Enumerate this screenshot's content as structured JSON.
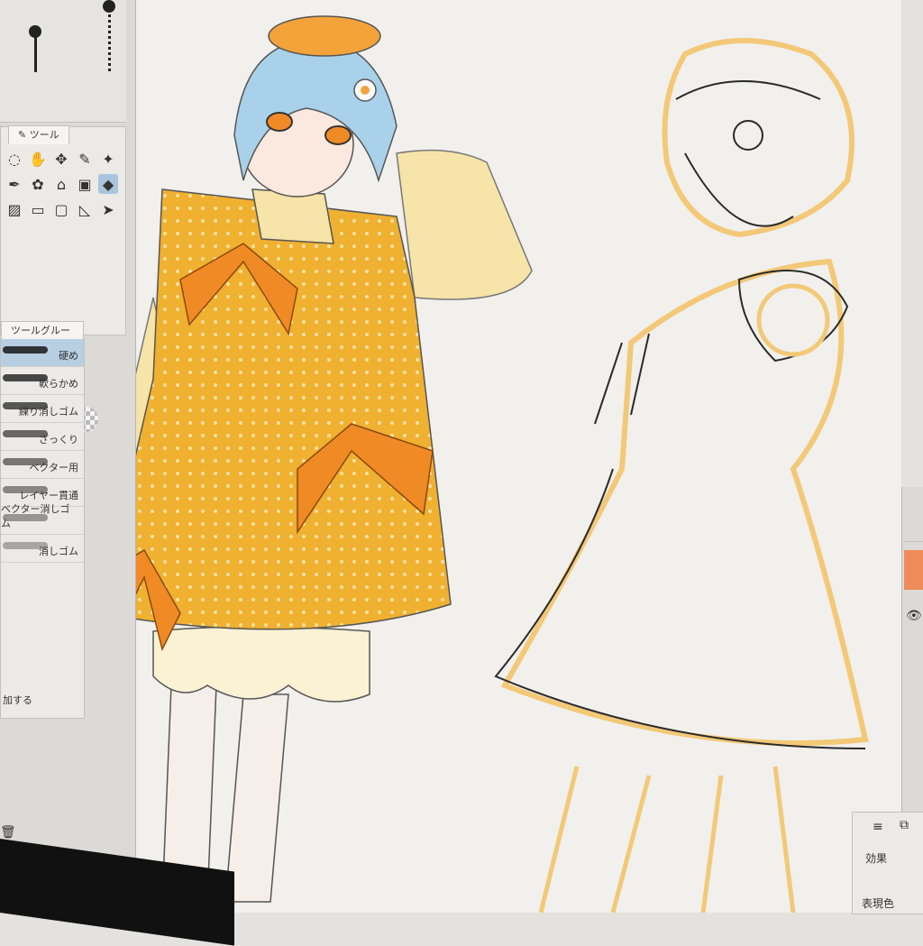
{
  "tool_panel": {
    "tab_label": "ツール",
    "tools": [
      {
        "name": "lasso-icon",
        "glyph": "◌",
        "active": false
      },
      {
        "name": "hand-icon",
        "glyph": "✋",
        "active": false
      },
      {
        "name": "move-icon",
        "glyph": "✥",
        "active": false
      },
      {
        "name": "eyedropper-icon",
        "glyph": "✎",
        "active": false
      },
      {
        "name": "magic-wand-icon",
        "glyph": "✦",
        "active": false
      },
      {
        "name": "pen-icon",
        "glyph": "✒",
        "active": false
      },
      {
        "name": "brush-icon",
        "glyph": "✿",
        "active": false
      },
      {
        "name": "fill-icon",
        "glyph": "⌂",
        "active": false
      },
      {
        "name": "figure-icon",
        "glyph": "▣",
        "active": false
      },
      {
        "name": "eraser-icon",
        "glyph": "◆",
        "active": true
      },
      {
        "name": "gradient-icon",
        "glyph": "▨",
        "active": false
      },
      {
        "name": "frame-icon",
        "glyph": "▭",
        "active": false
      },
      {
        "name": "ruler-icon",
        "glyph": "▢",
        "active": false
      },
      {
        "name": "text-icon",
        "glyph": "◺",
        "active": false
      },
      {
        "name": "select-icon",
        "glyph": "➤",
        "active": false
      }
    ],
    "colors": {
      "main": "#1b1b1b",
      "sub": "#d9607a",
      "transparent": "#cfcfcf"
    }
  },
  "subtool_panel": {
    "tab_label": "ツールグループ",
    "items": [
      {
        "label": "硬め",
        "active": true
      },
      {
        "label": "軟らかめ",
        "active": false
      },
      {
        "label": "練り消しゴム",
        "active": false
      },
      {
        "label": "ざっくり",
        "active": false
      },
      {
        "label": "ベクター用",
        "active": false
      },
      {
        "label": "レイヤー貫通",
        "active": false
      },
      {
        "label": "ベクター消しゴム",
        "active": false
      },
      {
        "label": "消しゴム",
        "active": false
      }
    ],
    "add_label": "加する"
  },
  "layer_panel": {
    "effect_label": "効果",
    "expression_label": "表現色",
    "accent_color": "#f08c5a"
  },
  "artwork": {
    "dress_color": "#f0b030",
    "ribbon_color": "#f08a24",
    "hair_color": "#a9d2ea",
    "sketch_color": "#f3c877",
    "line_color": "#2a2a2a"
  }
}
